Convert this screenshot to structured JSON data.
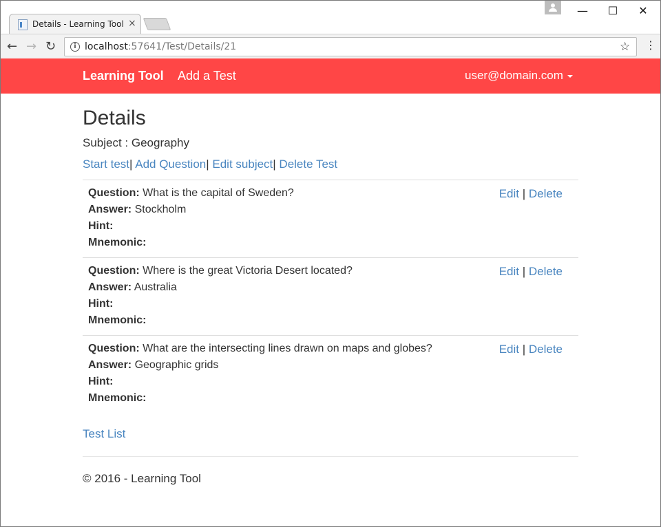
{
  "browser": {
    "tab_title": "Details - Learning Tool",
    "tab_close": "×",
    "url_host": "localhost",
    "url_path": ":57641/Test/Details/21",
    "icons": {
      "back": "arrow-left-icon",
      "forward": "arrow-right-icon",
      "reload": "reload-icon",
      "info": "info-icon",
      "bookmark": "star-icon",
      "menu": "kebab-menu-icon"
    },
    "window_controls": {
      "minimize": "—",
      "maximize": "☐",
      "close": "✕"
    }
  },
  "navbar": {
    "brand": "Learning Tool",
    "add_test": "Add a Test",
    "user": "user@domain.com",
    "color": "#ff4646"
  },
  "page": {
    "title": "Details",
    "subject_label": "Subject : ",
    "subject_value": "Geography",
    "actions": {
      "start": "Start test",
      "add_question": "Add Question",
      "edit_subject": "Edit subject",
      "delete_test": "Delete Test",
      "separator": "| "
    },
    "labels": {
      "question": "Question:",
      "answer": "Answer:",
      "hint": "Hint:",
      "mnemonic": "Mnemonic:",
      "edit": "Edit",
      "delete": "Delete",
      "pipe": " | "
    },
    "questions": [
      {
        "question": "What is the capital of Sweden?",
        "answer": "Stockholm",
        "hint": "",
        "mnemonic": ""
      },
      {
        "question": "Where is the great Victoria Desert located?",
        "answer": "Australia",
        "hint": "",
        "mnemonic": ""
      },
      {
        "question": "What are the intersecting lines drawn on maps and globes?",
        "answer": "Geographic grids",
        "hint": "",
        "mnemonic": ""
      }
    ],
    "back_link": "Test List",
    "footer": "© 2016 - Learning Tool",
    "link_color": "#4a86c0"
  }
}
